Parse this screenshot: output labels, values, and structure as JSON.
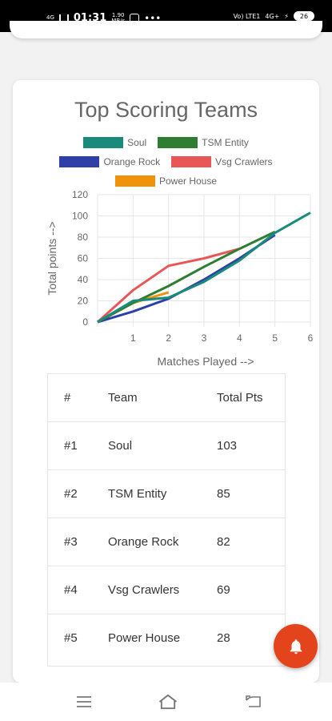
{
  "status_bar": {
    "time": "01:31",
    "signal_left": "4G",
    "speed_value": "1.90",
    "speed_unit": "MB/s",
    "dots": "•••",
    "carrier": "Vo) LTE1",
    "network": "4G+",
    "battery": "26"
  },
  "chart": {
    "title": "Top Scoring Teams",
    "legend": [
      "Soul",
      "TSM Entity",
      "Orange Rock",
      "Vsg Crawlers",
      "Power House"
    ],
    "xlabel": "Matches Played -->",
    "ylabel": "Total points -->"
  },
  "chart_data": {
    "type": "line",
    "title": "Top Scoring Teams",
    "xlabel": "Matches Played -->",
    "ylabel": "Total points -->",
    "x": [
      0,
      1,
      2,
      3,
      4,
      5,
      6
    ],
    "xlim": [
      0,
      6
    ],
    "ylim": [
      0,
      120
    ],
    "yticks": [
      0,
      20,
      40,
      60,
      80,
      100,
      120
    ],
    "xticks": [
      1,
      2,
      3,
      4,
      5,
      6
    ],
    "grid": true,
    "legend_position": "top",
    "series": [
      {
        "name": "Soul",
        "color": "#1a8a7a",
        "points": [
          [
            0,
            0
          ],
          [
            1,
            20
          ],
          [
            2,
            23
          ],
          [
            3,
            38
          ],
          [
            4,
            58
          ],
          [
            5,
            84
          ],
          [
            6,
            103
          ]
        ]
      },
      {
        "name": "TSM Entity",
        "color": "#2e7d32",
        "points": [
          [
            0,
            0
          ],
          [
            1,
            18
          ],
          [
            2,
            34
          ],
          [
            3,
            52
          ],
          [
            4,
            69
          ],
          [
            5,
            85
          ]
        ]
      },
      {
        "name": "Orange Rock",
        "color": "#2f3fa8",
        "points": [
          [
            0,
            0
          ],
          [
            1,
            10
          ],
          [
            2,
            22
          ],
          [
            3,
            40
          ],
          [
            4,
            60
          ],
          [
            5,
            82
          ]
        ]
      },
      {
        "name": "Vsg Crawlers",
        "color": "#e85656",
        "points": [
          [
            0,
            0
          ],
          [
            1,
            30
          ],
          [
            2,
            53
          ],
          [
            3,
            60
          ],
          [
            4,
            69
          ]
        ]
      },
      {
        "name": "Power House",
        "color": "#f0920a",
        "points": [
          [
            0,
            0
          ],
          [
            1,
            18
          ],
          [
            2,
            28
          ]
        ]
      }
    ]
  },
  "table": {
    "headers": [
      "#",
      "Team",
      "Total Pts"
    ],
    "rows": [
      [
        "#1",
        "Soul",
        "103"
      ],
      [
        "#2",
        "TSM Entity",
        "85"
      ],
      [
        "#3",
        "Orange Rock",
        "82"
      ],
      [
        "#4",
        "Vsg Crawlers",
        "69"
      ],
      [
        "#5",
        "Power House",
        "28"
      ]
    ]
  },
  "fab": {
    "icon": "bell-icon",
    "color": "#e4441c"
  },
  "nav": {
    "icons": [
      "menu-icon",
      "home-icon",
      "back-icon"
    ]
  }
}
